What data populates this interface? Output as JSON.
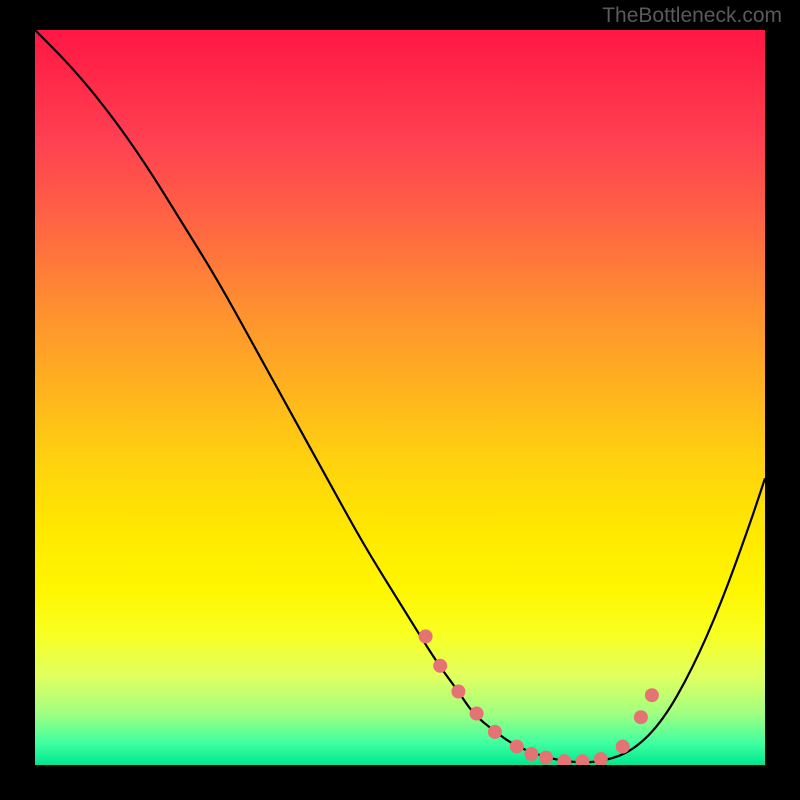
{
  "watermark": "TheBottleneck.com",
  "chart_data": {
    "type": "line",
    "title": "",
    "xlabel": "",
    "ylabel": "",
    "xlim": [
      0,
      100
    ],
    "ylim": [
      0,
      100
    ],
    "curve": {
      "x": [
        0,
        5,
        10,
        15,
        20,
        25,
        30,
        35,
        40,
        45,
        50,
        55,
        58,
        60,
        63,
        66,
        70,
        74,
        78,
        82,
        86,
        90,
        94,
        98,
        100
      ],
      "y": [
        100,
        95,
        89,
        82,
        74,
        66,
        57,
        48,
        39,
        30,
        22,
        14,
        10,
        7,
        4.5,
        2.5,
        1,
        0.3,
        0.5,
        2,
        6,
        13,
        22,
        33,
        39
      ]
    },
    "dots": {
      "x": [
        53.5,
        55.5,
        58.0,
        60.5,
        63.0,
        66.0,
        68.0,
        70.0,
        72.5,
        75.0,
        77.5,
        80.5,
        83.0,
        84.5
      ],
      "y": [
        17.5,
        13.5,
        10.0,
        7.0,
        4.5,
        2.5,
        1.5,
        1.0,
        0.5,
        0.5,
        0.8,
        2.5,
        6.5,
        9.5
      ]
    }
  }
}
